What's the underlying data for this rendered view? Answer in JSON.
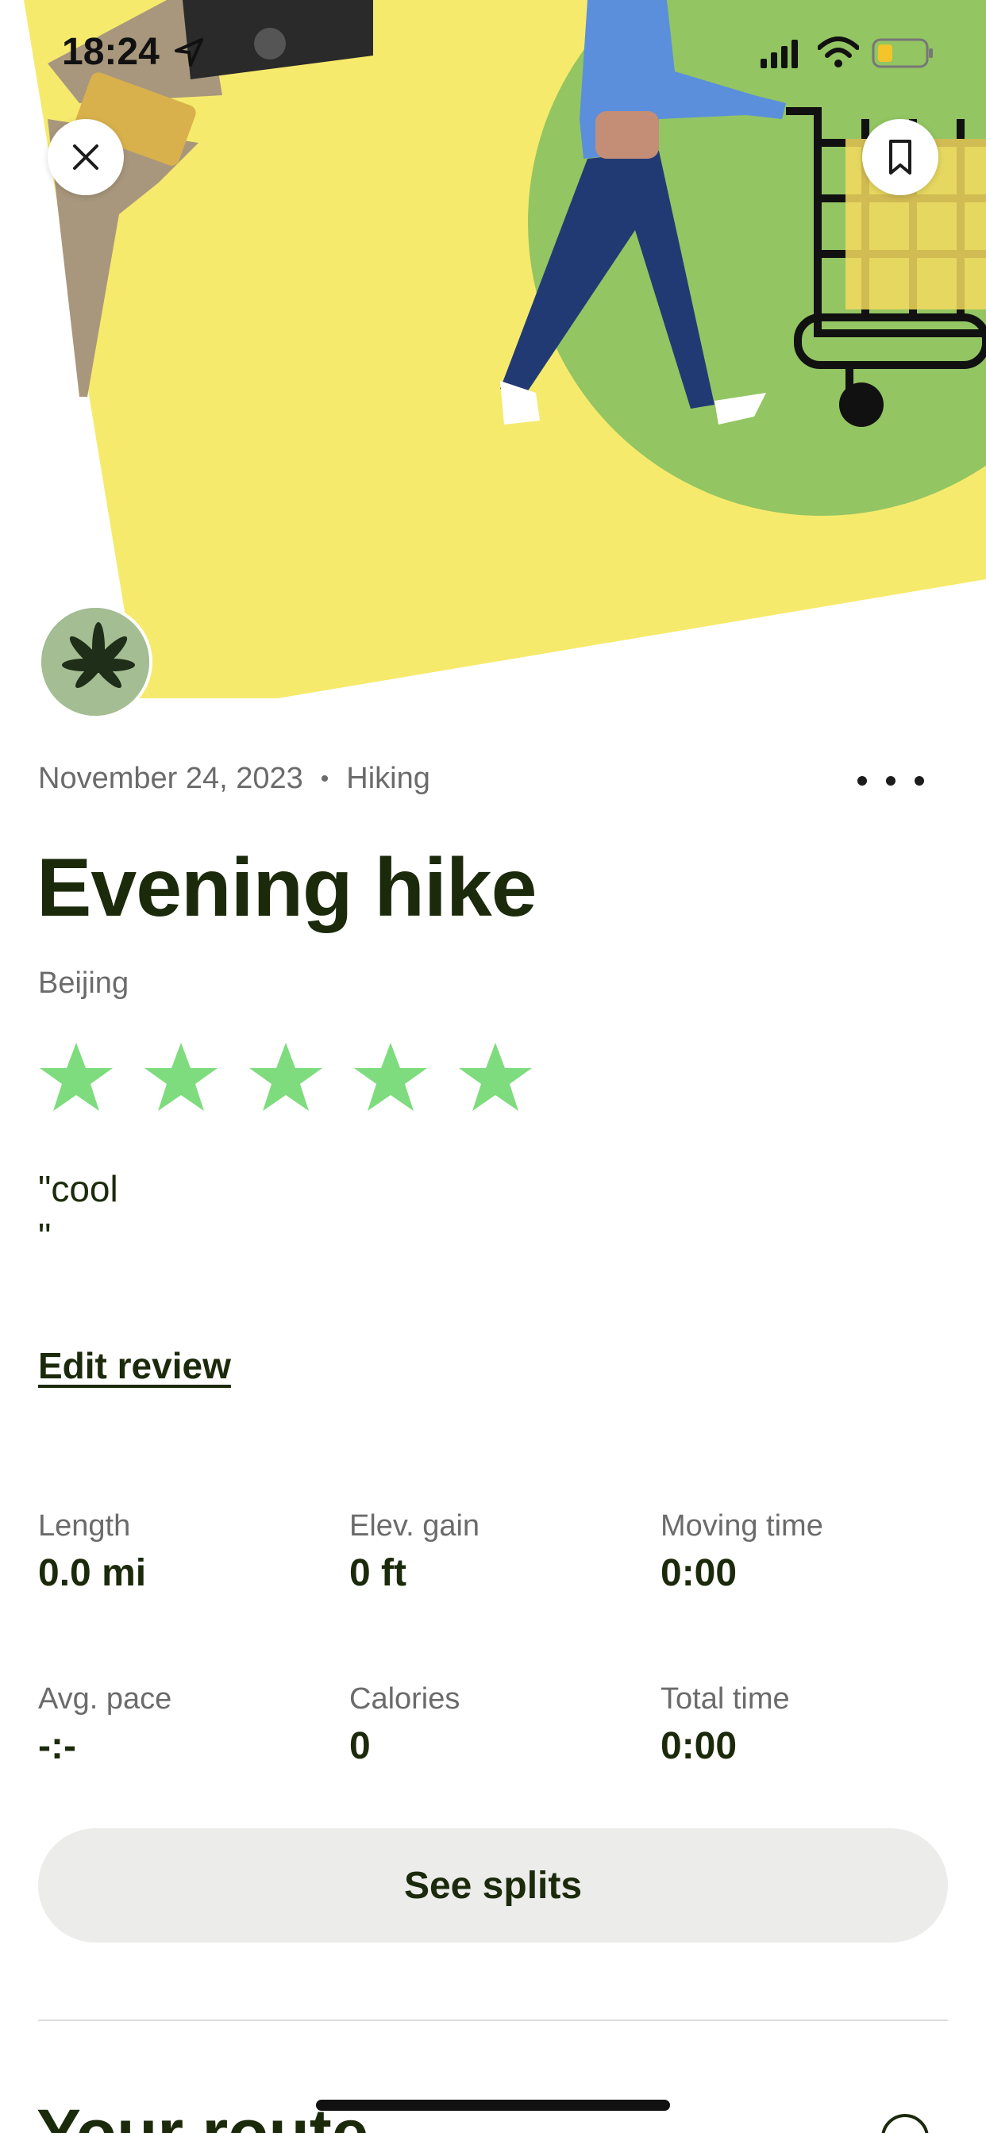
{
  "status_bar": {
    "time": "18:24"
  },
  "hero": {
    "image": "illustration of person pushing shopping cart"
  },
  "activity": {
    "date": "November 24, 2023",
    "separator": "•",
    "type": "Hiking",
    "title": "Evening hike",
    "location": "Beijing",
    "rating": 5,
    "rating_max": 5,
    "review": "\"cool\n\"",
    "edit_review_label": "Edit review"
  },
  "stats": [
    {
      "label": "Length",
      "value": "0.0 mi"
    },
    {
      "label": "Elev. gain",
      "value": "0 ft"
    },
    {
      "label": "Moving time",
      "value": "0:00"
    },
    {
      "label": "Avg. pace",
      "value": "-:-"
    },
    {
      "label": "Calories",
      "value": "0"
    },
    {
      "label": "Total time",
      "value": "0:00"
    }
  ],
  "splits_button_label": "See splits",
  "route_section_title": "Your route",
  "colors": {
    "star": "#7edc7e",
    "title": "#1c2a0c",
    "hero_yellow": "#f6ea6c",
    "hero_green": "#93c562"
  },
  "icons": [
    "close-icon",
    "bookmark-icon",
    "more-icon",
    "location-arrow-icon",
    "signal-icon",
    "wifi-icon",
    "battery-icon"
  ]
}
